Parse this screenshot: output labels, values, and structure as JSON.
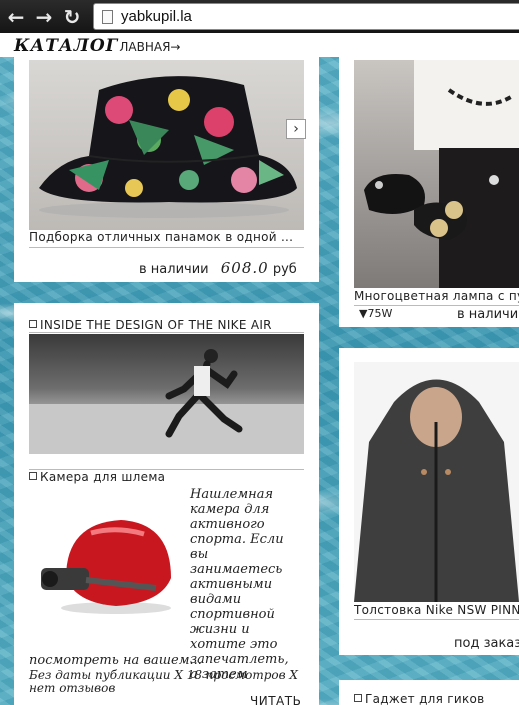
{
  "browser": {
    "url": "yabkupil.la"
  },
  "header": {
    "catalog": "КАТАЛОГ",
    "home_link": "ЛАВНАЯ→"
  },
  "cards": {
    "hats": {
      "caption": "Подборка отличных панамок в одной ...",
      "availability": "в наличии",
      "price": "608.0",
      "currency": "руб"
    },
    "lamp": {
      "caption": "Многоцветная лампа с пу",
      "power": "75W",
      "availability": "в наличи"
    },
    "nike": {
      "title": "INSIDE THE DESIGN OF THE NIKE AIR"
    },
    "camera": {
      "title": "Камера для шлема",
      "description": "Нашлемная камера для активного спорта. Если вы занимаетесь активными видами спортивной жизни и хотите это запечатлеть, а затем",
      "description_cont": "посмотреть на вашем...",
      "meta": "Без даты публикации Х 18 просмотров Х нет отзывов",
      "read_more": "ЧИТАТЬ"
    },
    "hoodie": {
      "caption": "Толстовка Nike NSW PINN",
      "order": "под заказ"
    },
    "gadget": {
      "title": "Гаджет для гиков"
    }
  }
}
